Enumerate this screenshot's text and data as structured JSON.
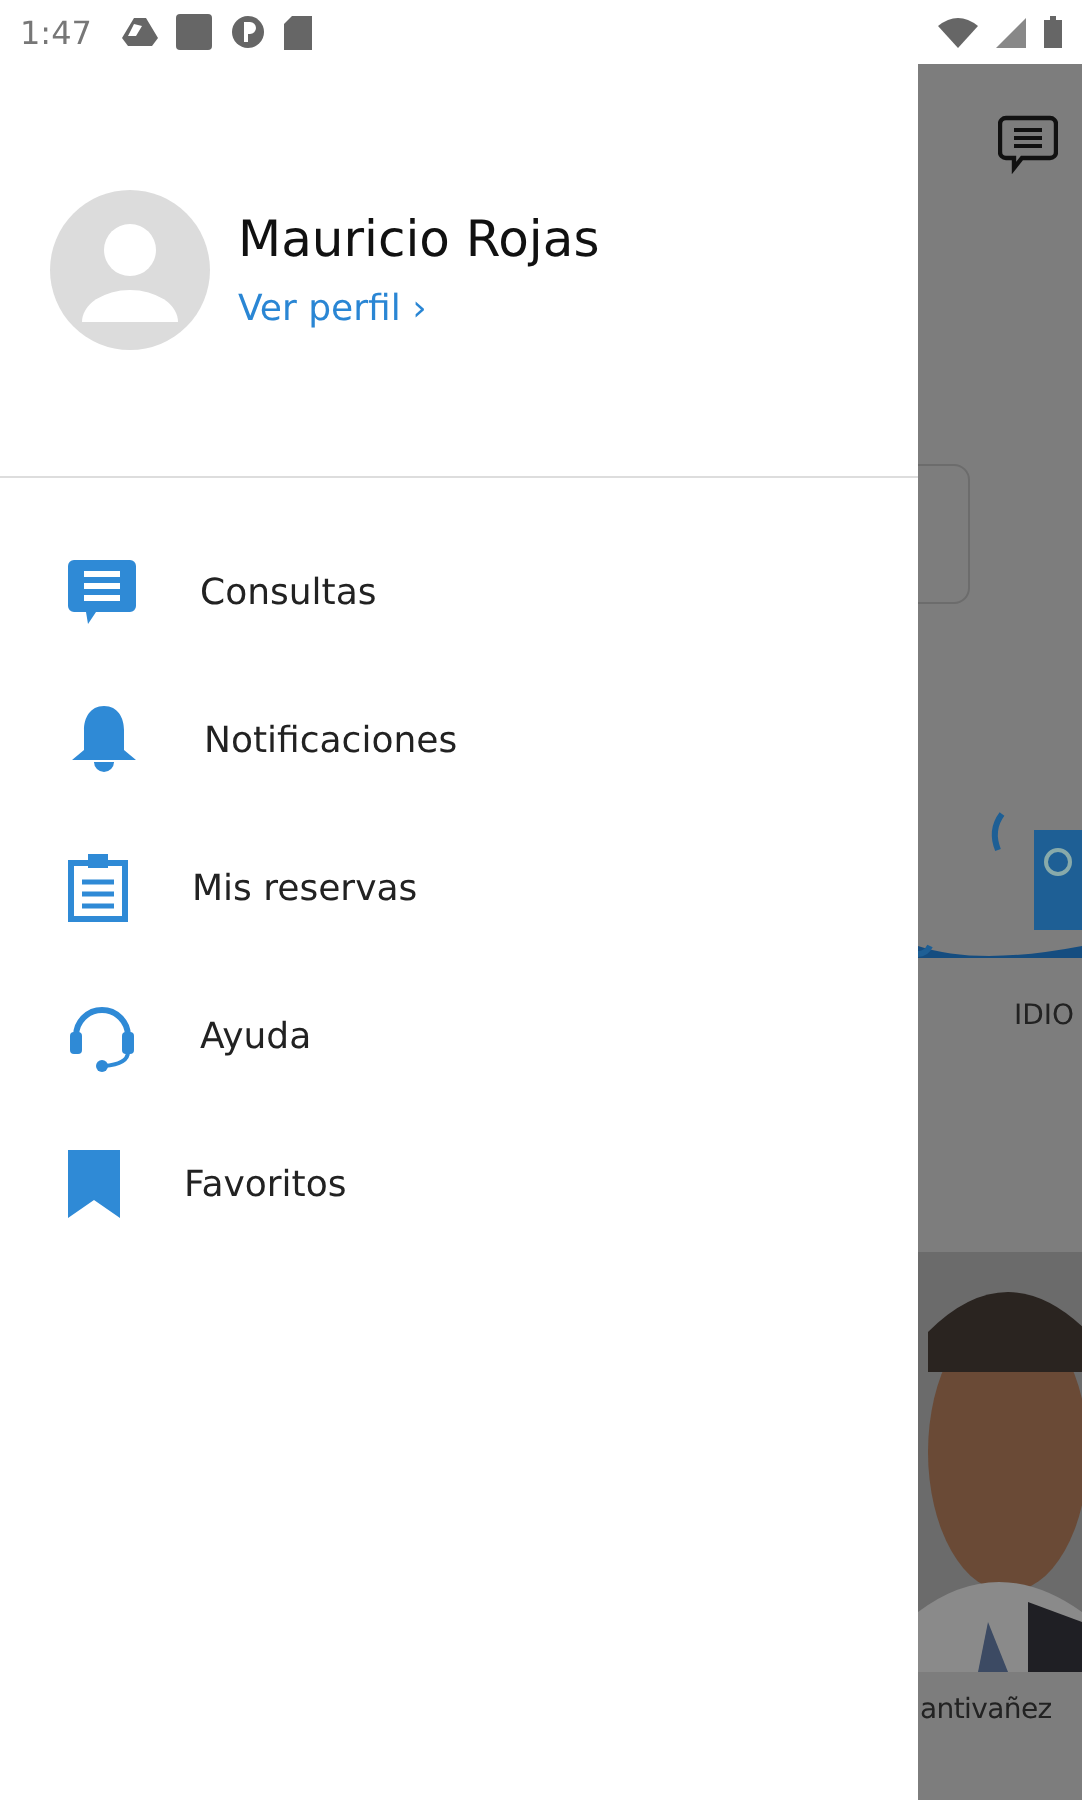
{
  "status_bar": {
    "time": "1:47"
  },
  "drawer": {
    "profile": {
      "name": "Mauricio Rojas",
      "link": "Ver perfil ›"
    },
    "items": [
      {
        "label": "Consultas",
        "kind": "chat"
      },
      {
        "label": "Notificaciones",
        "kind": "bell"
      },
      {
        "label": "Mis reservas",
        "kind": "clipboard"
      },
      {
        "label": "Ayuda",
        "kind": "headset"
      },
      {
        "label": "Favoritos",
        "kind": "bookmark"
      }
    ]
  },
  "background": {
    "category_label": "IDIO",
    "person_name": "antivañez"
  }
}
